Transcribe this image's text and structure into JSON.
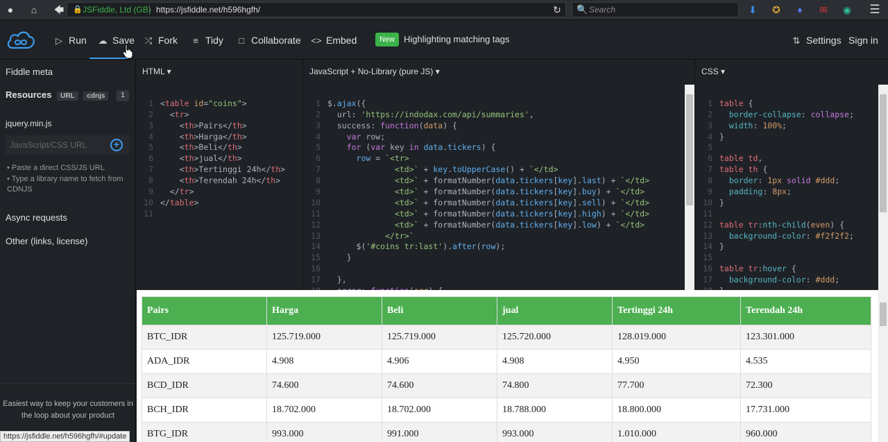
{
  "browser": {
    "site_identity": "JSFiddle, Ltd (GB)",
    "url": "https://jsfiddle.net/h596hgfh/",
    "search_placeholder": "Search",
    "status_url": "https://jsfiddle.net/h596hgfh/#update"
  },
  "toolbar": {
    "run": "Run",
    "save": "Save",
    "fork": "Fork",
    "tidy": "Tidy",
    "collaborate": "Collaborate",
    "embed": "Embed",
    "new_badge": "New",
    "news": "Highlighting matching tags",
    "settings": "Settings",
    "sign_in": "Sign in"
  },
  "sidebar": {
    "fiddle_meta": "Fiddle meta",
    "resources": "Resources",
    "tag_url": "URL",
    "tag_cdnjs": "cdnjs",
    "resource_count": "1",
    "resource_file": "jquery.min.js",
    "input_placeholder": "JavaScript/CSS URL",
    "hint1": "Paste a direct CSS/JS URL",
    "hint2": "Type a library name to fetch from CDNJS",
    "async": "Async requests",
    "other": "Other (links, license)",
    "promo": "Easiest way to keep your customers in the loop about your product"
  },
  "panels": {
    "html_label": "HTML",
    "js_label": "JavaScript + No-Library (pure JS)",
    "css_label": "CSS"
  },
  "result": {
    "headers": [
      "Pairs",
      "Harga",
      "Beli",
      "jual",
      "Tertinggi 24h",
      "Terendah 24h"
    ],
    "rows": [
      [
        "BTC_IDR",
        "125.719.000",
        "125.719.000",
        "125.720.000",
        "128.019.000",
        "123.301.000"
      ],
      [
        "ADA_IDR",
        "4.908",
        "4.906",
        "4.908",
        "4.950",
        "4.535"
      ],
      [
        "BCD_IDR",
        "74.600",
        "74.600",
        "74.800",
        "77.700",
        "72.300"
      ],
      [
        "BCH_IDR",
        "18.702.000",
        "18.702.000",
        "18.788.000",
        "18.800.000",
        "17.731.000"
      ],
      [
        "BTG_IDR",
        "993.000",
        "991.000",
        "993.000",
        "1.010.000",
        "960.000"
      ]
    ]
  }
}
